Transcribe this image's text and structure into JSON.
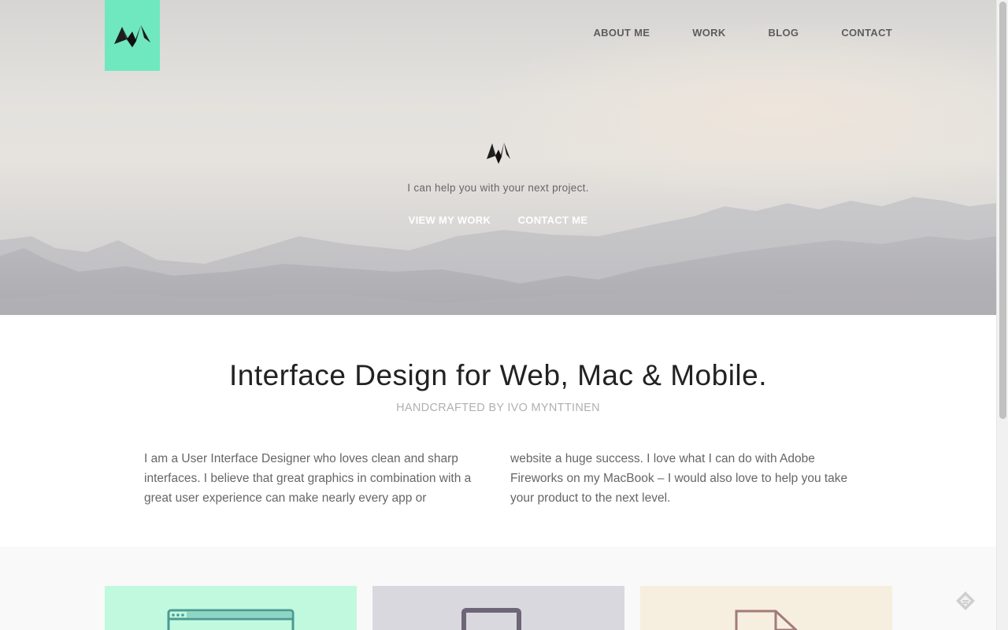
{
  "nav": {
    "items": [
      "ABOUT ME",
      "WORK",
      "BLOG",
      "CONTACT"
    ]
  },
  "hero": {
    "tagline": "I can help you with your next project.",
    "cta_work": "VIEW MY WORK",
    "cta_contact": "CONTACT ME"
  },
  "intro": {
    "headline": "Interface Design for Web, Mac & Mobile.",
    "subhead": "HANDCRAFTED BY IVO MYNTTINEN",
    "paragraph_left": "I am a User Interface Designer who loves clean and sharp interfaces. I believe that great graphics in combination with a great user experience can make nearly every app or",
    "paragraph_right": "website a huge success. I love what I can do with Adobe Fireworks on my MacBook – I would also love to help you take your product to the next level."
  },
  "services": {
    "cards": [
      {
        "icon": "browser-window-icon",
        "color": "#c0f9de"
      },
      {
        "icon": "tablet-device-icon",
        "color": "#d9d8de"
      },
      {
        "icon": "document-icon",
        "color": "#f6efdf"
      }
    ]
  },
  "colors": {
    "accent": "#6fe8bf",
    "cta_text": "#ffffff",
    "headline": "#222222"
  },
  "icons": {
    "logo": "monogram-m-icon",
    "floating": "feedly-icon"
  }
}
